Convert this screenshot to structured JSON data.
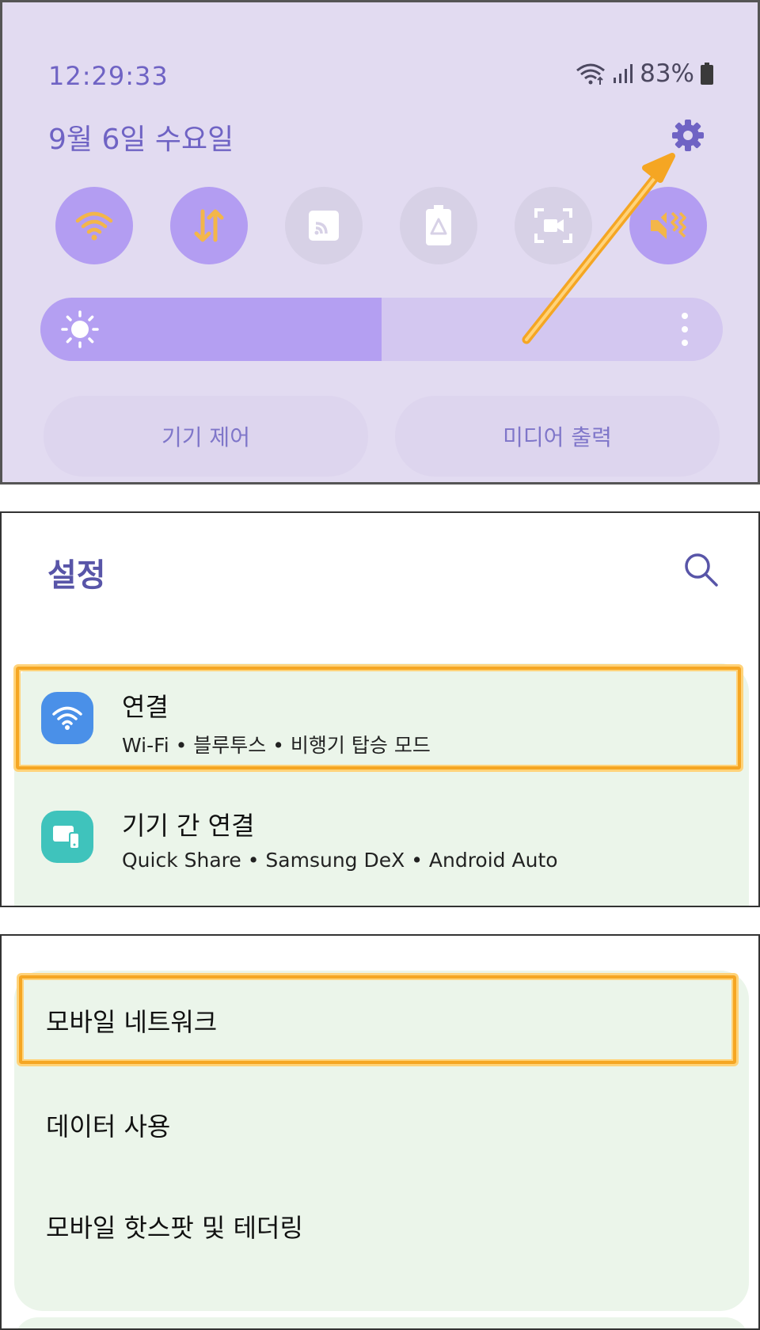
{
  "quick_panel": {
    "time": "12:29:33",
    "date": "9월 6일 수요일",
    "battery_pct": "83%",
    "tiles": [
      {
        "name": "wifi",
        "icon": "wifi-icon",
        "state": "on"
      },
      {
        "name": "mobile-data",
        "icon": "data-arrows-icon",
        "state": "on"
      },
      {
        "name": "cast",
        "icon": "cast-icon",
        "state": "off"
      },
      {
        "name": "power-saving",
        "icon": "battery-saver-icon",
        "state": "off"
      },
      {
        "name": "screen-recorder",
        "icon": "screen-record-icon",
        "state": "off"
      },
      {
        "name": "sound",
        "icon": "vibrate-icon",
        "state": "on"
      }
    ],
    "brightness_level": 0.5,
    "device_control_label": "기기 제어",
    "media_output_label": "미디어 출력",
    "colors": {
      "background": "#e2dbf1",
      "accent": "#6f63c4",
      "tile_on": "#b39df2",
      "highlight": "#f5a623"
    }
  },
  "settings": {
    "title": "설정",
    "items": [
      {
        "title": "연결",
        "subtitle": "Wi-Fi • 블루투스 • 비행기 탑승 모드",
        "icon": "wifi-icon",
        "icon_color": "#4a90e8",
        "highlighted": true
      },
      {
        "title": "기기 간 연결",
        "subtitle": "Quick Share • Samsung DeX • Android Auto",
        "icon": "devices-icon",
        "icon_color": "#3fc3bc",
        "highlighted": false
      }
    ]
  },
  "connections": {
    "items": [
      {
        "label": "모바일 네트워크",
        "highlighted": true
      },
      {
        "label": "데이터 사용",
        "highlighted": false
      },
      {
        "label": "모바일 핫스팟 및 테더링",
        "highlighted": false
      }
    ]
  }
}
